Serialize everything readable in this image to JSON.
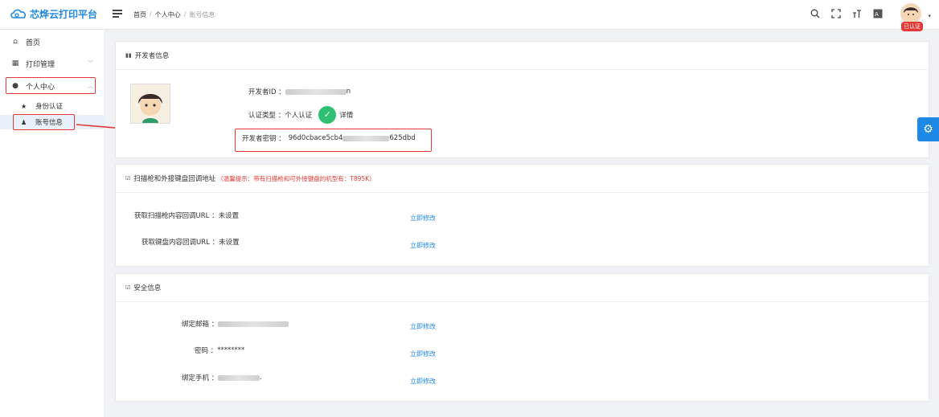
{
  "app": {
    "title": "芯烨云打印平台"
  },
  "breadcrumb": {
    "home": "首页",
    "center": "个人中心",
    "current": "账号信息",
    "sep": "/"
  },
  "header_tools": {
    "search": "search-icon",
    "fullscreen": "fullscreen-icon",
    "font": "font-size-icon",
    "translate": "translate-icon"
  },
  "user": {
    "badge": "已认证"
  },
  "sidebar": {
    "home": "首页",
    "print_mgmt": "打印管理",
    "personal_center": "个人中心",
    "identity": "身份认证",
    "account_info": "账号信息"
  },
  "developer": {
    "section_title": "开发者信息",
    "id_label": "开发者ID ：",
    "id_suffix": "n",
    "type_label": "认证类型 ：",
    "type_value": "个人认证",
    "detail": "详情",
    "secret_label": "开发者密钥 ：",
    "secret_prefix": "96d0cbace5cb4",
    "secret_suffix": "625dbd"
  },
  "scanner": {
    "section_title": "扫描枪和外接键盘回调地址",
    "warning": "（温馨提示：带有扫描枪和可外接键盘的机型有：T895K）",
    "scan_label": "获取扫描枪内容回调URL ：",
    "scan_value": "未设置",
    "keyboard_label": "获取键盘内容回调URL ：",
    "keyboard_value": "未设置",
    "modify": "立即修改"
  },
  "security": {
    "section_title": "安全信息",
    "email_label": "绑定邮箱 ：",
    "password_label": "密码 ：",
    "password_value": "********",
    "phone_label": "绑定手机 ：",
    "phone_suffix": ".",
    "modify": "立即修改"
  },
  "colors": {
    "accent": "#1e88e5",
    "highlight": "#e53935",
    "success": "#2fbf71"
  }
}
